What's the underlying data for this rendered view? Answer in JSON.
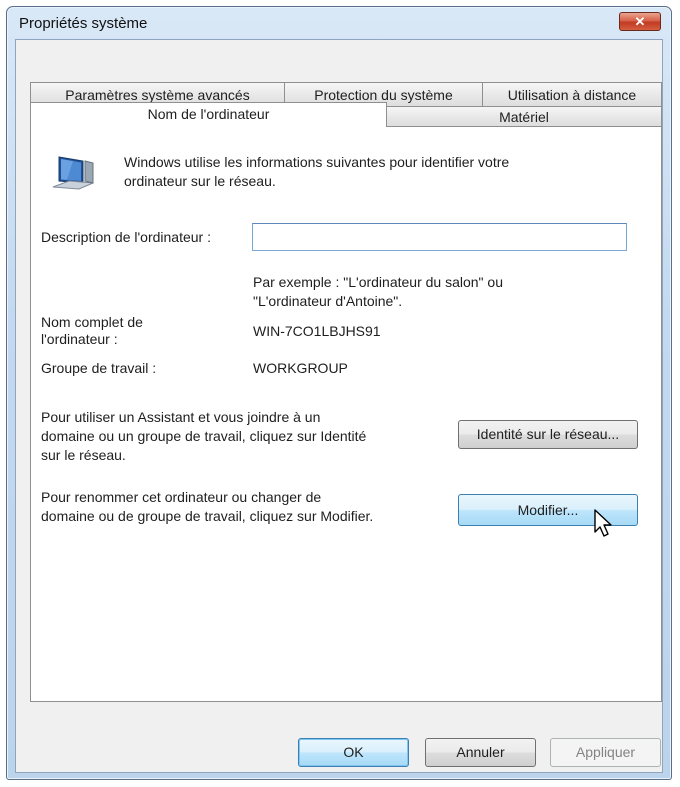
{
  "window": {
    "title": "Propriétés système",
    "close_label": "✕"
  },
  "tabs": {
    "row1": [
      "Paramètres système avancés",
      "Protection du système",
      "Utilisation à distance"
    ],
    "row2": [
      "Nom de l'ordinateur",
      "Matériel"
    ]
  },
  "panel": {
    "intro": [
      "Windows utilise les informations suivantes pour identifier votre",
      "ordinateur sur le réseau."
    ],
    "description_label": "Description de l'ordinateur :",
    "description_value": "",
    "example": [
      "Par exemple : \"L'ordinateur du salon\" ou",
      "\"L'ordinateur d'Antoine\"."
    ],
    "fullname_label": [
      "Nom complet de",
      "l'ordinateur :"
    ],
    "fullname_value": "WIN-7CO1LBJHS91",
    "workgroup_label": "Groupe de travail :",
    "workgroup_value": "WORKGROUP",
    "network_text": [
      "Pour utiliser un Assistant et vous joindre à un",
      "domaine ou un groupe de travail, cliquez sur Identité",
      "sur le réseau."
    ],
    "network_button": "Identité sur le réseau...",
    "rename_text": [
      "Pour renommer cet ordinateur ou changer de",
      "domaine ou de groupe de travail, cliquez sur Modifier."
    ],
    "rename_button": "Modifier..."
  },
  "footer": {
    "ok": "OK",
    "cancel": "Annuler",
    "apply": "Appliquer"
  },
  "colors": {
    "accent": "#3c7fb1",
    "close": "#c23a22",
    "frame": "#bcd3ec"
  }
}
